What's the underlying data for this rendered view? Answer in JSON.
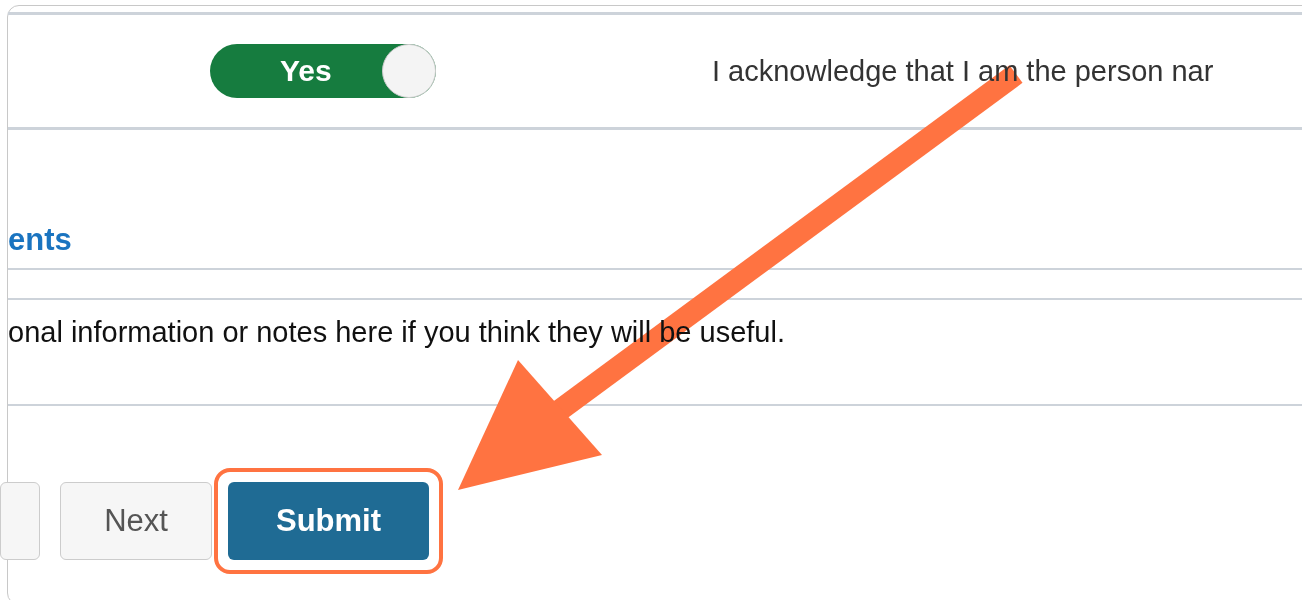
{
  "consent": {
    "toggle": {
      "label": "Yes",
      "on": true
    },
    "statement": "I acknowledge that I am the person nar"
  },
  "section": {
    "heading": "ents",
    "text": "onal information or notes here if you think they will be useful."
  },
  "buttons": [
    {
      "kind": "cut"
    },
    {
      "kind": "secondary",
      "label": "Next"
    },
    {
      "kind": "primary",
      "label": "Submit"
    }
  ],
  "annotations": {
    "highlight_ring": true,
    "arrow": true
  }
}
